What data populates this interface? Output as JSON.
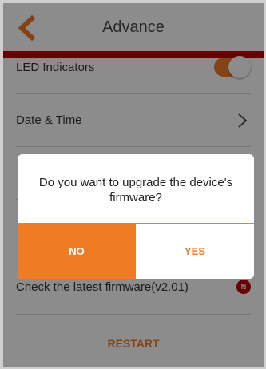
{
  "header": {
    "title": "Advance",
    "back_icon": "chevron-left-icon"
  },
  "settings": {
    "led_label": "LED Indicators",
    "led_on": true,
    "date_time_label": "Date & Time",
    "firmware_label": "Check the latest firmware(v2.01)",
    "firmware_badge": "N",
    "restart_label": "RESTART"
  },
  "dialog": {
    "message": "Do you want to upgrade the device's firmware?",
    "no_label": "NO",
    "yes_label": "YES"
  },
  "colors": {
    "accent": "#f07b25",
    "brand_red": "#c00000"
  }
}
